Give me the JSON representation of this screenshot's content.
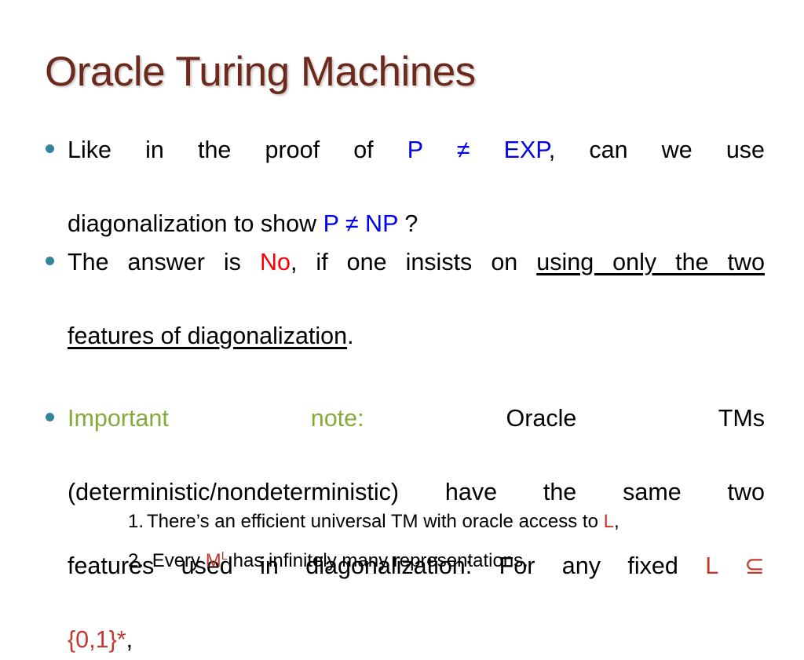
{
  "slide": {
    "title": "Oracle Turing Machines",
    "title_color": "#6B2A1C",
    "bullet_color": "#31859C",
    "accent_blue": "#0000EE",
    "accent_red": "#FF0000",
    "accent_brick": "#C23B30",
    "accent_olive": "#86A93C",
    "background": "#FFFFFF"
  },
  "bullets": [
    {
      "id": "bullet-1",
      "line1_a": "Like in the proof of ",
      "line1_blue": "P  ≠  EXP",
      "line1_b": ", can we use",
      "line2_a": "diagonalization to show ",
      "line2_blue": "P ≠ NP",
      "line2_b": " ?"
    },
    {
      "id": "bullet-2",
      "line1_a": "The answer is ",
      "line1_red": "No",
      "line1_b": ", if one insists on ",
      "line1_underline": "using only the two",
      "line2_underline": "features of diagonalization",
      "line2_b": "."
    },
    {
      "id": "bullet-3",
      "line1_olive": "Important note:",
      "line1_b": "Oracle TMs",
      "line2": "(deterministic/nondeterministic) have the same two",
      "line3_a": "features used in diagonalization:  For any fixed ",
      "line3_brick": "L ⊆",
      "line4_brick": "{0,1}*",
      "line4_b": ","
    }
  ],
  "sublist": [
    {
      "number": "1.",
      "text_a": "There’s an efficient universal TM with oracle access to ",
      "symbol": "L",
      "text_b": ","
    },
    {
      "number": "2.",
      "text_a": "Every ",
      "symbol": "M",
      "symbol_sup": "L",
      "text_b": " has infinitely many representations."
    }
  ]
}
